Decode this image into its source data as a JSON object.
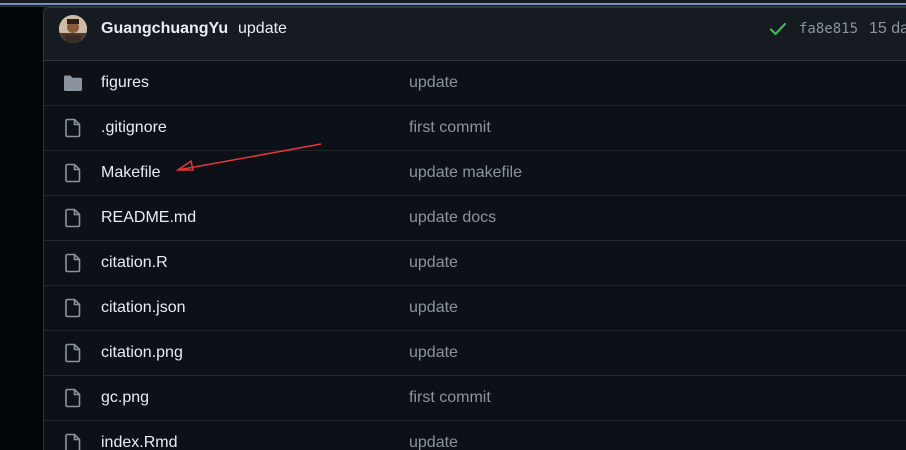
{
  "commit": {
    "author": "GuangchuangYu",
    "message": "update",
    "sha": "fa8e815",
    "age": "15 da"
  },
  "files": [
    {
      "name": "figures",
      "message": "update",
      "icon": "folder-icon"
    },
    {
      "name": ".gitignore",
      "message": "first commit",
      "icon": "file-icon"
    },
    {
      "name": "Makefile",
      "message": "update makefile",
      "icon": "file-icon"
    },
    {
      "name": "README.md",
      "message": "update docs",
      "icon": "file-icon"
    },
    {
      "name": "citation.R",
      "message": "update",
      "icon": "file-icon"
    },
    {
      "name": "citation.json",
      "message": "update",
      "icon": "file-icon"
    },
    {
      "name": "citation.png",
      "message": "update",
      "icon": "file-icon"
    },
    {
      "name": "gc.png",
      "message": "first commit",
      "icon": "file-icon"
    },
    {
      "name": "index.Rmd",
      "message": "update",
      "icon": "file-icon"
    }
  ],
  "colors": {
    "background": "#0d1117",
    "header": "#161b22",
    "text": "#e6edf3",
    "muted": "#8b949e",
    "success": "#3fb950",
    "annotation": "#e5343b"
  }
}
